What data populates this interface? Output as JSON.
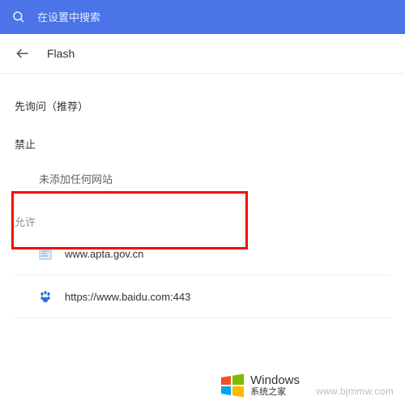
{
  "header": {
    "search_placeholder": "在设置中搜索"
  },
  "page": {
    "title": "Flash"
  },
  "setting": {
    "ask_first_label": "先询问（推荐）"
  },
  "blocked": {
    "label": "禁止",
    "empty_text": "未添加任何网站"
  },
  "allowed": {
    "label": "允许",
    "sites": [
      {
        "url": "www.apta.gov.cn",
        "icon": "page-icon"
      },
      {
        "url": "https://www.baidu.com:443",
        "icon": "baidu-icon"
      }
    ]
  },
  "watermark": {
    "url": "www.bjmmw.com",
    "win_main": "Windows",
    "win_sub": "系统之家"
  },
  "colors": {
    "header_bg": "#4a74e8",
    "highlight": "#ff0000"
  }
}
